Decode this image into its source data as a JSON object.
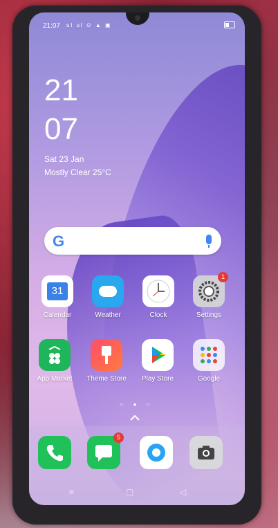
{
  "status_bar": {
    "time": "21:07",
    "icons": "ul ul ⊙ ▲ ▣"
  },
  "lockclock": {
    "hour": "21",
    "minute": "07",
    "date": "Sat 23 Jan",
    "weather": "Mostly Clear 25°C"
  },
  "search": {
    "logo": "G"
  },
  "apps_row1": [
    {
      "label": "Calendar",
      "icon": "calendar-icon",
      "text": "31"
    },
    {
      "label": "Weather",
      "icon": "weather-icon"
    },
    {
      "label": "Clock",
      "icon": "clock-icon"
    },
    {
      "label": "Settings",
      "icon": "settings-icon",
      "badge": "1"
    }
  ],
  "apps_row2": [
    {
      "label": "App Market",
      "icon": "app-market-icon"
    },
    {
      "label": "Theme Store",
      "icon": "theme-store-icon"
    },
    {
      "label": "Play Store",
      "icon": "play-store-icon"
    },
    {
      "label": "Google",
      "icon": "google-folder-icon"
    }
  ],
  "dock": [
    {
      "icon": "phone-icon"
    },
    {
      "icon": "messages-icon",
      "badge": "5"
    },
    {
      "icon": "browser-icon"
    },
    {
      "icon": "camera-icon"
    }
  ],
  "page_dots": "○ ● ○",
  "nav": {
    "menu": "≡",
    "home": "▢",
    "back": "◁"
  }
}
